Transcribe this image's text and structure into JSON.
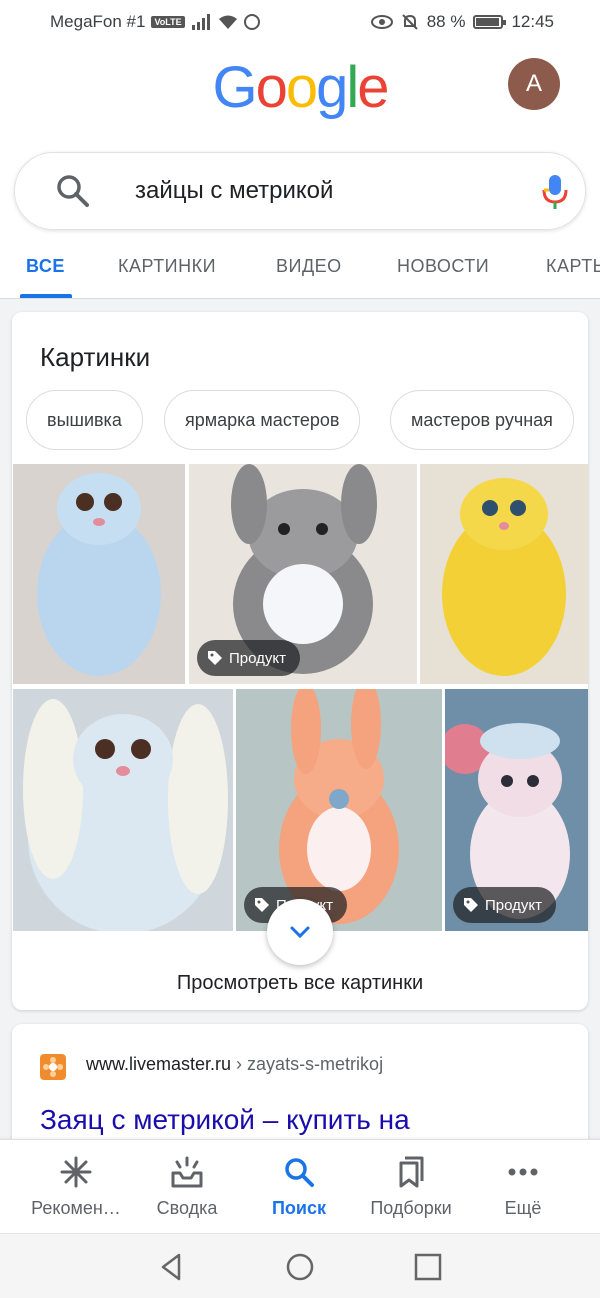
{
  "status_bar": {
    "carrier": "MegaFon #1",
    "volte": "VoLTE",
    "battery": "88 %",
    "time": "12:45"
  },
  "header": {
    "logo": [
      "G",
      "o",
      "o",
      "g",
      "l",
      "e"
    ],
    "logo_colors": [
      "#4285F4",
      "#EA4335",
      "#FBBC05",
      "#4285F4",
      "#34A853",
      "#EA4335"
    ],
    "avatar_letter": "A"
  },
  "search": {
    "query": "зайцы с метрикой"
  },
  "tabs": [
    "ВСЕ",
    "КАРТИНКИ",
    "ВИДЕО",
    "НОВОСТИ",
    "КАРТЫ"
  ],
  "images_card": {
    "title": "Картинки",
    "chips": [
      "вышивка",
      "ярмарка мастеров",
      "мастеров ручная"
    ],
    "badge_label": "Продукт",
    "view_all": "Просмотреть все картинки"
  },
  "result": {
    "domain": "www.livemaster.ru",
    "path": " › zayats-s-metrikoj",
    "title": "Заяц с метрикой – купить на"
  },
  "bottom_nav": {
    "items": [
      "Рекомен…",
      "Сводка",
      "Поиск",
      "Подборки",
      "Ещё"
    ]
  },
  "colors": {
    "accent": "#1a73e8",
    "link": "#1a0dab"
  }
}
